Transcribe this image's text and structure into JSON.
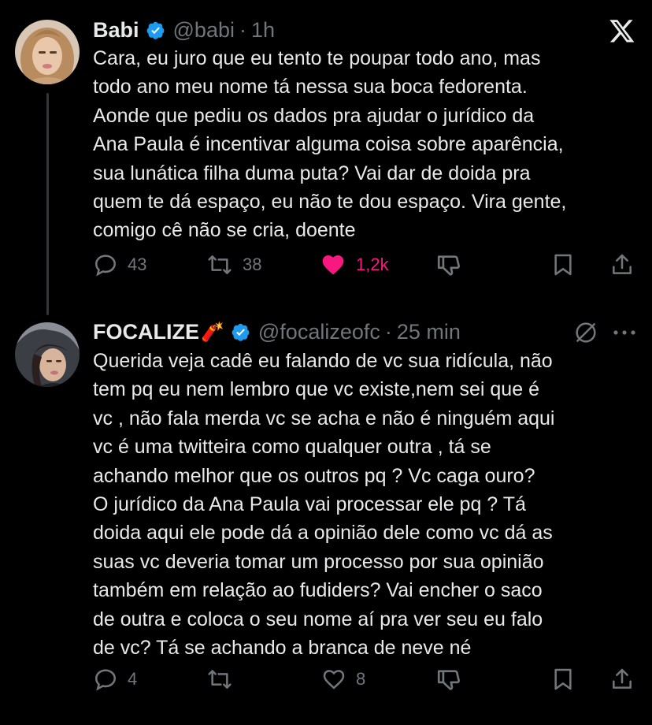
{
  "tweets": [
    {
      "name": "Babi",
      "handle": "@babi",
      "time": "1h",
      "text": "Cara, eu juro que eu tento te poupar todo ano, mas\ntodo ano meu nome tá nessa sua boca fedorenta.\nAonde que pediu os dados pra ajudar o jurídico da\nAna Paula é incentivar alguma coisa sobre aparência,\nsua lunática filha duma puta? Vai dar de doida pra\nquem te dá espaço, eu não te dou espaço. Vira gente,\ncomigo cê não se cria, doente",
      "replies": "43",
      "retweets": "38",
      "likes": "1,2k",
      "liked": true,
      "verified": true
    },
    {
      "name": "FOCALIZE",
      "name_emoji": "🧨",
      "handle": "@focalizeofc",
      "time": "25 min",
      "text": "Querida veja cadê eu falando de vc sua ridícula, não\ntem pq eu nem lembro que vc existe,nem sei que é\nvc , não fala merda vc se acha e não é ninguém aqui\nvc é uma twitteira como qualquer outra , tá se\nachando melhor que os outros pq ? Vc caga ouro?\nO jurídico da Ana Paula vai processar ele pq ? Tá\ndoida aqui ele pode dá a opinião dele como vc dá as\nsuas vc deveria tomar um processo por sua opinião\ntambém em relação ao fudiders? Vai encher o saco\nde outra e coloca o seu nome aí pra ver seu eu falo\nde vc? Tá se achando a branca de neve né",
      "replies": "4",
      "retweets": "",
      "likes": "8",
      "liked": false,
      "verified": true
    }
  ],
  "colors": {
    "background": "#000000",
    "text": "#e7e9ea",
    "muted": "#71767b",
    "verified": "#1d9bf0",
    "like": "#f91880"
  },
  "icons": [
    "x-logo-icon",
    "verified-icon",
    "reply-icon",
    "retweet-icon",
    "like-icon",
    "downvote-icon",
    "bookmark-icon",
    "share-icon",
    "ban-icon",
    "more-icon"
  ]
}
